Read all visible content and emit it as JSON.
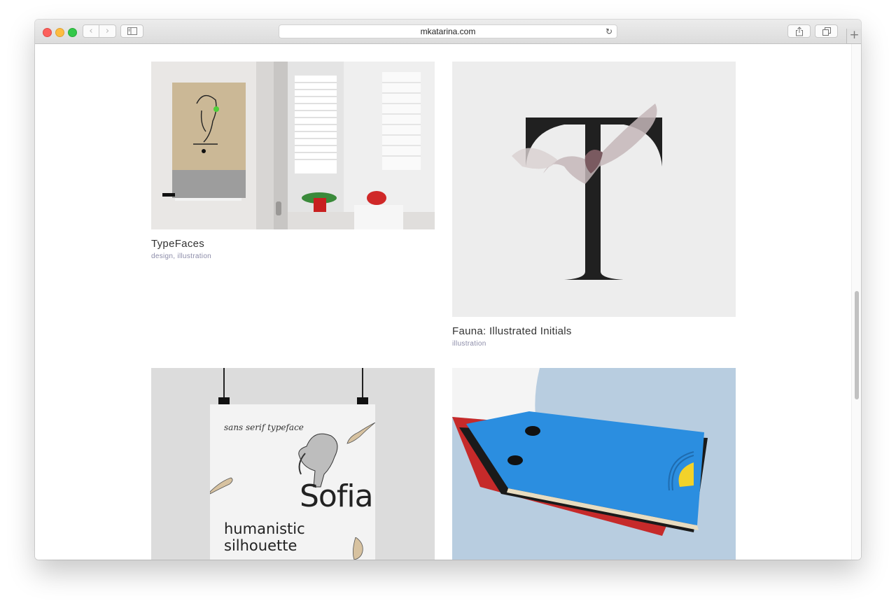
{
  "browser": {
    "url": "mkatarina.com",
    "back_icon": "‹",
    "forward_icon": "›",
    "reload_icon": "↻",
    "new_tab_icon": "+"
  },
  "projects": [
    {
      "title": "TypeFaces",
      "tags": "design, illustration"
    },
    {
      "title": "Fauna: Illustrated Initials",
      "tags": "illustration"
    },
    {
      "title": "",
      "tags": "",
      "poster": {
        "kicker": "sans serif typeface",
        "name": "Sofia",
        "tagline": "humanistic silhouette"
      }
    },
    {
      "title": "",
      "tags": ""
    }
  ],
  "colors": {
    "accent_tag": "#8b8ba8",
    "title_text": "#333333"
  }
}
